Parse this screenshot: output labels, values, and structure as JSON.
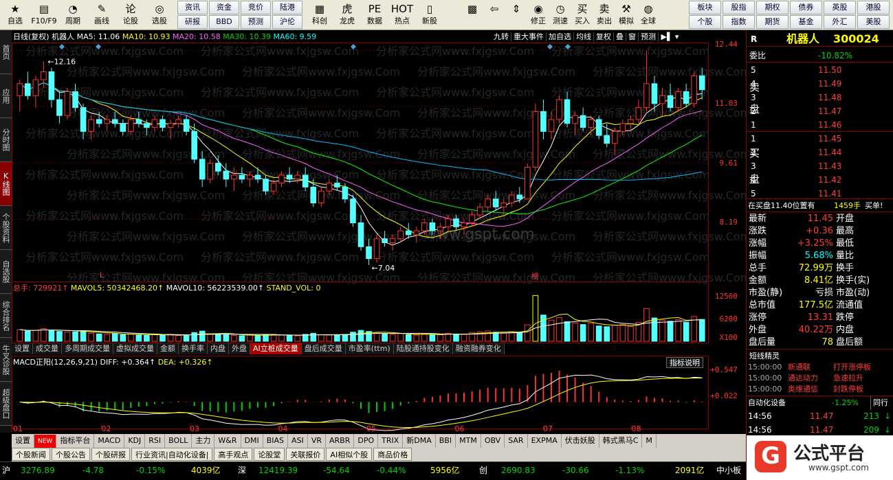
{
  "toolbar": {
    "left": [
      {
        "label": "自选",
        "icon": "★"
      },
      {
        "label": "F10/F9",
        "icon": "▤"
      },
      {
        "label": "周期",
        "icon": "◔"
      },
      {
        "label": "画线",
        "icon": "✎"
      },
      {
        "label": "论股",
        "icon": "论"
      },
      {
        "label": "选股",
        "icon": "◎"
      }
    ],
    "stacks": [
      [
        "资讯",
        "研报"
      ],
      [
        "资金",
        "BBD"
      ],
      [
        "竞价",
        "预测"
      ],
      [
        "陆港",
        "沪伦"
      ]
    ],
    "mid": [
      {
        "label": "科创",
        "icon": "▦"
      },
      {
        "label": "龙虎",
        "icon": "虎"
      },
      {
        "label": "数据",
        "icon": "PE"
      },
      {
        "label": "热点",
        "icon": "HOT"
      },
      {
        "label": "新股",
        "icon": "▯"
      }
    ],
    "right": [
      {
        "label": "",
        "icon": "▩"
      },
      {
        "label": "",
        "icon": "⇦"
      },
      {
        "label": "",
        "icon": "⇕"
      },
      {
        "label": "修正",
        "icon": "◉"
      },
      {
        "label": "测速",
        "icon": "◷"
      },
      {
        "label": "买入",
        "icon": "买"
      },
      {
        "label": "卖出",
        "icon": "卖"
      },
      {
        "label": "模拟",
        "icon": "⚒"
      },
      {
        "label": "全球",
        "icon": "◍"
      }
    ],
    "stacks2": [
      [
        "板块",
        "个股"
      ],
      [
        "股指",
        "指数"
      ],
      [
        "期权",
        "期货"
      ],
      [
        "债券",
        "基金"
      ],
      [
        "英股",
        "外汇"
      ],
      [
        "港股",
        "美股"
      ]
    ]
  },
  "lefttabs": [
    "首页",
    "应用",
    "分时图",
    "K线图",
    "个股资料",
    "自选股",
    "综合排名",
    "牛叉诊股",
    "超级盘口"
  ],
  "chart": {
    "header": {
      "period": "日线(复权)",
      "name": "机器人",
      "ma5": "MA5: 11.06",
      "ma10": "MA10: 10.93",
      "ma20": "MA20: 10.58",
      "ma30": "MA30: 10.39",
      "ma60": "MA60: 9.59"
    },
    "toolbuttons": [
      "九转",
      "重大事件",
      "加自选",
      "均线",
      "复权",
      "叠",
      "窗",
      "预测"
    ],
    "price_axis": [
      "12.44",
      "11.03",
      "9.61",
      "8.19"
    ],
    "hi_label": "12.16",
    "lo_label": "7.04",
    "markers": [
      "L",
      "榜"
    ],
    "vol_header": {
      "total": "总手: 729921↑",
      "m5": "MAVOL5: 50342468.20↑",
      "m10": "MAVOL10: 56223539.00↑",
      "std": "STAND_VOL: 0"
    },
    "vol_axis": [
      "12560",
      "6280",
      "X100"
    ],
    "tabs": [
      "设置",
      "成交量",
      "多周期成交量",
      "虚拟成交量",
      "金额",
      "换手率",
      "内盘",
      "外盘",
      "AI立桩成交量",
      "盘后成交量",
      "市盈率(ttm)",
      "陆股通持股变化",
      "融资融券变化"
    ],
    "active_tab": "AI立桩成交量",
    "macd_header": {
      "name": "MACD正阳(12,26,9,21)",
      "diff": "DIFF: +0.364↑",
      "dea": "DEA: +0.326↑"
    },
    "macd_btn": "指标说明",
    "macd_axis": [
      "+0.547",
      "+0.022"
    ],
    "months": [
      "01",
      "02",
      "03",
      "04",
      "05",
      "06",
      "07",
      "08"
    ],
    "watermark": "分析家公式网www.fxjgsw.Com",
    "watermark2": "www.gspt.com",
    "candles": [
      [
        11.3,
        11.7,
        10.9,
        11.6
      ],
      [
        11.6,
        11.9,
        11.2,
        11.3
      ],
      [
        11.3,
        11.8,
        11.0,
        11.7
      ],
      [
        11.7,
        12.16,
        11.5,
        11.9
      ],
      [
        11.9,
        12.0,
        11.0,
        11.2
      ],
      [
        11.2,
        11.4,
        10.6,
        10.8
      ],
      [
        10.8,
        11.5,
        10.7,
        11.4
      ],
      [
        11.4,
        11.6,
        10.9,
        11.0
      ],
      [
        11.0,
        11.1,
        10.2,
        10.4
      ],
      [
        10.4,
        10.8,
        10.2,
        10.7
      ],
      [
        10.7,
        10.9,
        10.5,
        10.6
      ],
      [
        10.6,
        10.8,
        10.4,
        10.7
      ],
      [
        10.7,
        10.9,
        10.5,
        10.6
      ],
      [
        10.6,
        10.7,
        10.3,
        10.4
      ],
      [
        10.4,
        10.8,
        10.3,
        10.7
      ],
      [
        10.7,
        10.9,
        10.5,
        10.6
      ],
      [
        10.6,
        10.7,
        10.3,
        10.5
      ],
      [
        10.5,
        10.8,
        10.4,
        10.7
      ],
      [
        10.7,
        10.8,
        10.4,
        10.5
      ],
      [
        10.5,
        10.7,
        10.2,
        10.6
      ],
      [
        10.6,
        10.8,
        10.5,
        10.7
      ],
      [
        10.7,
        10.8,
        10.3,
        10.4
      ],
      [
        10.4,
        10.6,
        9.6,
        9.7
      ],
      [
        9.7,
        9.9,
        9.0,
        9.2
      ],
      [
        9.2,
        9.7,
        9.1,
        9.6
      ],
      [
        9.6,
        9.8,
        9.3,
        9.4
      ],
      [
        9.4,
        9.6,
        9.0,
        9.2
      ],
      [
        9.2,
        9.5,
        8.9,
        9.3
      ],
      [
        9.3,
        9.5,
        9.1,
        9.2
      ],
      [
        9.2,
        9.4,
        9.0,
        9.3
      ],
      [
        9.3,
        9.5,
        9.1,
        9.2
      ],
      [
        9.2,
        9.3,
        8.8,
        8.9
      ],
      [
        8.9,
        9.2,
        8.8,
        9.1
      ],
      [
        9.1,
        9.4,
        9.0,
        9.3
      ],
      [
        9.3,
        9.5,
        9.1,
        9.2
      ],
      [
        9.2,
        9.4,
        9.1,
        9.3
      ],
      [
        9.3,
        9.5,
        8.9,
        9.0
      ],
      [
        9.0,
        9.2,
        8.5,
        8.6
      ],
      [
        8.6,
        9.0,
        8.5,
        8.9
      ],
      [
        8.9,
        9.2,
        8.8,
        9.1
      ],
      [
        9.1,
        9.3,
        8.9,
        9.0
      ],
      [
        9.0,
        9.1,
        8.6,
        8.7
      ],
      [
        8.7,
        8.8,
        8.0,
        8.1
      ],
      [
        8.1,
        8.3,
        7.4,
        7.5
      ],
      [
        7.5,
        7.7,
        7.04,
        7.2
      ],
      [
        7.2,
        7.8,
        7.1,
        7.7
      ],
      [
        7.7,
        7.9,
        7.5,
        7.6
      ],
      [
        7.6,
        7.8,
        7.4,
        7.7
      ],
      [
        7.7,
        8.0,
        7.6,
        7.9
      ],
      [
        7.9,
        8.1,
        7.7,
        7.8
      ],
      [
        7.8,
        8.0,
        7.6,
        7.9
      ],
      [
        7.9,
        8.2,
        7.8,
        8.1
      ],
      [
        8.1,
        8.2,
        7.8,
        7.9
      ],
      [
        7.9,
        8.1,
        7.7,
        8.0
      ],
      [
        8.0,
        8.3,
        7.9,
        8.2
      ],
      [
        8.2,
        8.3,
        7.9,
        8.0
      ],
      [
        8.0,
        8.2,
        7.8,
        8.1
      ],
      [
        8.1,
        8.4,
        8.0,
        8.3
      ],
      [
        8.3,
        8.6,
        8.2,
        8.5
      ],
      [
        8.5,
        8.8,
        8.4,
        8.7
      ],
      [
        8.7,
        8.9,
        8.4,
        8.5
      ],
      [
        8.5,
        8.7,
        8.3,
        8.6
      ],
      [
        8.6,
        8.9,
        8.5,
        8.8
      ],
      [
        8.8,
        9.0,
        8.6,
        8.7
      ],
      [
        8.7,
        9.6,
        8.7,
        9.5
      ],
      [
        9.5,
        11.1,
        9.4,
        10.9
      ],
      [
        10.9,
        11.2,
        10.2,
        10.4
      ],
      [
        10.4,
        10.9,
        10.2,
        10.7
      ],
      [
        10.7,
        11.3,
        10.6,
        11.2
      ],
      [
        11.2,
        11.4,
        10.5,
        10.6
      ],
      [
        10.6,
        10.9,
        10.3,
        10.8
      ],
      [
        10.8,
        11.0,
        10.4,
        10.5
      ],
      [
        10.5,
        10.8,
        10.3,
        10.7
      ],
      [
        10.7,
        10.8,
        10.2,
        10.3
      ],
      [
        10.3,
        10.6,
        10.0,
        10.1
      ],
      [
        10.1,
        10.5,
        9.8,
        10.4
      ],
      [
        10.4,
        10.7,
        10.3,
        10.6
      ],
      [
        10.6,
        10.8,
        10.4,
        10.7
      ],
      [
        10.7,
        11.2,
        10.6,
        11.0
      ],
      [
        11.0,
        12.44,
        10.9,
        11.6
      ],
      [
        11.6,
        11.8,
        10.9,
        11.1
      ],
      [
        11.1,
        11.5,
        10.8,
        11.3
      ],
      [
        11.3,
        11.6,
        10.9,
        11.0
      ],
      [
        11.0,
        11.5,
        10.9,
        11.4
      ],
      [
        11.4,
        11.6,
        11.0,
        11.1
      ],
      [
        11.1,
        11.9,
        11.0,
        11.8
      ],
      [
        11.8,
        12.0,
        11.2,
        11.45
      ]
    ],
    "volumes": [
      3.2,
      2.8,
      3.0,
      3.5,
      3.1,
      2.7,
      2.5,
      2.6,
      2.9,
      2.2,
      2.0,
      1.9,
      2.1,
      1.8,
      2.0,
      1.7,
      1.6,
      1.8,
      1.7,
      1.9,
      1.6,
      1.5,
      2.4,
      2.8,
      2.0,
      1.9,
      1.8,
      1.6,
      1.5,
      1.7,
      1.6,
      1.8,
      1.9,
      1.7,
      1.6,
      1.5,
      1.9,
      2.2,
      1.8,
      1.7,
      1.6,
      1.9,
      2.5,
      3.0,
      2.7,
      2.3,
      2.0,
      1.9,
      2.1,
      1.8,
      1.7,
      2.0,
      1.9,
      1.8,
      2.2,
      2.0,
      1.9,
      2.4,
      2.6,
      2.8,
      2.5,
      2.3,
      2.6,
      2.4,
      4.5,
      12.56,
      7.2,
      5.8,
      6.5,
      5.4,
      5.0,
      4.6,
      4.9,
      4.2,
      4.0,
      4.4,
      4.6,
      4.1,
      5.2,
      9.0,
      6.4,
      5.8,
      5.5,
      5.9,
      5.2,
      6.8,
      6.0
    ],
    "ma_colors": {
      "ma5": "#ffffff",
      "ma10": "#ffff00",
      "ma20": "#ff60ff",
      "ma30": "#00ff00",
      "ma60": "#00bfff"
    }
  },
  "rp": {
    "code": "R",
    "name": "机器人",
    "symbol": "300024",
    "wb_label": "委比",
    "wb": "-10.82%",
    "sells": [
      {
        "n": "5",
        "p": "11.50"
      },
      {
        "n": "4",
        "p": "11.49"
      },
      {
        "n": "3",
        "p": "11.48"
      },
      {
        "n": "2",
        "p": "11.47"
      },
      {
        "n": "1",
        "p": "11.46"
      }
    ],
    "buys": [
      {
        "n": "1",
        "p": "11.45"
      },
      {
        "n": "2",
        "p": "11.44"
      },
      {
        "n": "3",
        "p": "11.43"
      },
      {
        "n": "4",
        "p": "11.42"
      },
      {
        "n": "5",
        "p": "11.41"
      }
    ],
    "sell_lbl": [
      "卖",
      "盘"
    ],
    "buy_lbl": [
      "买",
      "盘"
    ],
    "notice_a": "在买盘11.40位置有",
    "notice_b": "1459手",
    "notice_c": "买单!",
    "quote": [
      {
        "l": "最新",
        "v": "11.45",
        "r": "开盘",
        "c": "red"
      },
      {
        "l": "涨跌",
        "v": "+0.36",
        "r": "最高",
        "c": "red"
      },
      {
        "l": "涨幅",
        "v": "+3.25%",
        "r": "最低",
        "c": "red"
      },
      {
        "l": "振幅",
        "v": "5.68%",
        "r": "量比",
        "c": "cyan"
      },
      {
        "l": "总手",
        "v": "72.99万",
        "r": "换手",
        "c": "yel"
      },
      {
        "l": "金额",
        "v": "8.41亿",
        "r": "换手(实)",
        "c": "yel"
      },
      {
        "l": "市盈(静)",
        "v": "亏损",
        "r": "市盈(动)",
        "c": "white"
      },
      {
        "l": "总市值",
        "v": "177.5亿",
        "r": "流通值",
        "c": "yel"
      },
      {
        "l": "涨停",
        "v": "13.31",
        "r": "跌停",
        "c": "red"
      },
      {
        "l": "外盘",
        "v": "40.22万",
        "r": "内盘",
        "c": "red"
      },
      {
        "l": "盘后量",
        "v": "78",
        "r": "盘后额",
        "c": "yel"
      }
    ],
    "sprite_title": "短线精灵",
    "sprites": [
      {
        "t": "15:00:00",
        "s": "新通联",
        "e": "打开涨停板"
      },
      {
        "t": "15:00:00",
        "s": "通达动力",
        "e": "急速拉升"
      },
      {
        "t": "15:00:00",
        "s": "奥维通信",
        "e": "封跌停板"
      }
    ],
    "sector": "自动化设备",
    "sector_chg": "-1.25%",
    "sector_btn": "同行",
    "ticks": [
      {
        "t": "14:56",
        "p": "11.47",
        "v": "213"
      },
      {
        "t": "14:56",
        "p": "11.47",
        "v": "209"
      }
    ]
  },
  "bottom_tabs": [
    "设置",
    "NEW",
    "指标平台",
    "MACD",
    "KDJ",
    "RSI",
    "BOLL",
    "主力",
    "W&R",
    "DMI",
    "BIAS",
    "ASI",
    "VR",
    "ARBR",
    "DPO",
    "TRIX",
    "新DMA",
    "BBI",
    "MTM",
    "OBV",
    "SAR",
    "EXPMA",
    "伏击妖股",
    "韩式黑马C",
    "M"
  ],
  "info_tabs": [
    "个股新闻",
    "个股公告",
    "个股研报",
    "行业资讯|自动化设备|",
    "高手观点",
    "论股堂",
    "关联报价",
    "AI相似个股",
    "商品价格"
  ],
  "status": {
    "sh": "沪",
    "sh_v": "3276.89",
    "sh_c": "-4.78",
    "sh_p": "-0.15%",
    "sh_a": "4039亿",
    "sz": "深",
    "sz_v": "12419.39",
    "sz_c": "-54.64",
    "sz_p": "-0.44%",
    "sz_a": "5956亿",
    "cy": "创",
    "cy_v": "2690.83",
    "cy_c": "-30.66",
    "cy_p": "-1.13%",
    "cy_a": "2091亿",
    "zx": "中小板"
  },
  "logo": {
    "cn": "公式平台",
    "url": "www.gspt.com"
  }
}
